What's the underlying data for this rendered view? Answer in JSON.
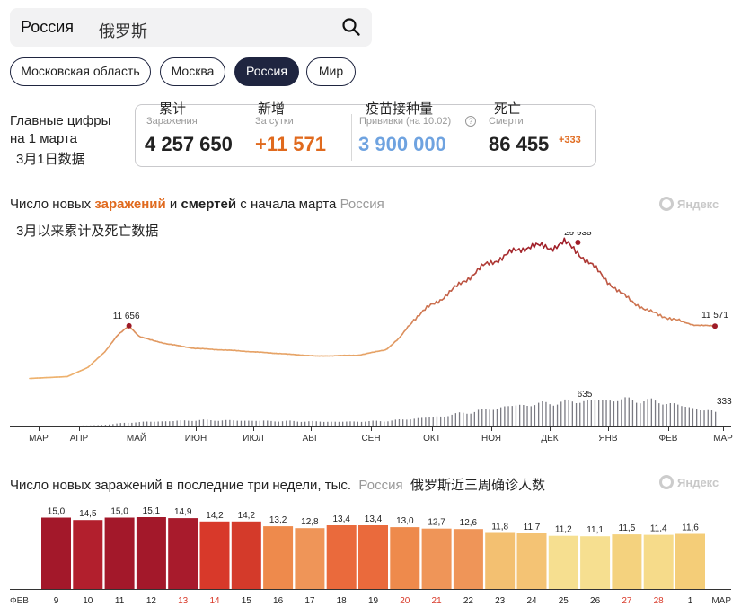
{
  "search": {
    "query": "Россия",
    "query_cn": "俄罗斯"
  },
  "regions": [
    "Московская область",
    "Москва",
    "Россия",
    "Мир"
  ],
  "regions_active": "Россия",
  "summary": {
    "title_line1": "Главные цифры",
    "title_line2": "на 1 марта",
    "subtitle_cn": "3月1日数据",
    "cases_cn": "累计",
    "cases_label": "Заражения",
    "cases_value": "4 257 650",
    "daily_cn": "新增",
    "daily_label": "За сутки",
    "daily_value": "+11 571",
    "vacc_cn": "疫苗接种量",
    "vacc_label": "Прививки (на 10.02)",
    "vacc_value": "3 900 000",
    "deaths_cn": "死亡",
    "deaths_label": "Смерти",
    "deaths_value": "86 455",
    "deaths_delta": "+333"
  },
  "colors": {
    "cases": "#e06a1e",
    "vaccine": "#6fa3e0",
    "deaths_delta": "#e06a1e",
    "active_chip": "#1f2540",
    "dark_red": "#9e1b27",
    "bars_grey": "#7a7a82"
  },
  "chart1": {
    "title_pre": "Число новых ",
    "title_cases": "заражений",
    "title_mid": " и ",
    "title_deaths": "смертей",
    "title_post": " с начала марта",
    "title_region": "Россия",
    "subtitle_cn": "3月以来累计及死亡数据",
    "watermark": "Яндекс"
  },
  "chart2": {
    "title": "Число новых заражений в последние три недели, тыс.",
    "title_region": "Россия",
    "title_cn": "俄罗斯近三周确诊人数",
    "watermark": "Яндекс"
  },
  "chart_data": [
    {
      "type": "line",
      "months": [
        "МАР",
        "АПР",
        "МАЙ",
        "ИЮН",
        "ИЮЛ",
        "АВГ",
        "СЕН",
        "ОКТ",
        "НОЯ",
        "ДЕК",
        "ЯНВ",
        "ФЕВ",
        "МАР"
      ],
      "cases_keypoints_x": [
        0,
        0.055,
        0.085,
        0.11,
        0.128,
        0.145,
        0.16,
        0.175,
        0.2,
        0.24,
        0.3,
        0.36,
        0.42,
        0.48,
        0.52,
        0.54,
        0.56,
        0.58,
        0.6,
        0.62,
        0.66,
        0.7,
        0.73,
        0.76,
        0.78,
        0.8,
        0.83,
        0.86,
        0.9,
        0.94,
        0.97,
        1.0
      ],
      "cases_keypoints": [
        100,
        500,
        2500,
        6000,
        9500,
        11656,
        9300,
        8600,
        7700,
        6700,
        6200,
        5600,
        5000,
        5200,
        6400,
        9000,
        13000,
        15500,
        17500,
        19800,
        24500,
        27500,
        29200,
        28800,
        29935,
        27800,
        23500,
        19000,
        15000,
        13000,
        11800,
        11571
      ],
      "deaths_keypoints_x": [
        0,
        0.1,
        0.15,
        0.25,
        0.35,
        0.45,
        0.52,
        0.6,
        0.7,
        0.8,
        0.87,
        0.92,
        1.0
      ],
      "deaths_keypoints": [
        0,
        30,
        100,
        150,
        130,
        110,
        130,
        240,
        480,
        600,
        635,
        580,
        333
      ],
      "labels": {
        "first_peak": "11 656",
        "max_cases": "29 935",
        "last_cases": "11 571",
        "max_deaths": "635",
        "last_deaths": "333"
      }
    },
    {
      "type": "bar",
      "categories": [
        "9",
        "10",
        "11",
        "12",
        "13",
        "14",
        "15",
        "16",
        "17",
        "18",
        "19",
        "20",
        "21",
        "22",
        "23",
        "24",
        "25",
        "26",
        "27",
        "28",
        "1"
      ],
      "weekend_flags": [
        false,
        false,
        false,
        false,
        true,
        true,
        false,
        false,
        false,
        false,
        false,
        true,
        true,
        false,
        false,
        false,
        false,
        false,
        true,
        true,
        false
      ],
      "values": [
        15.0,
        14.5,
        15.0,
        15.1,
        14.9,
        14.2,
        14.2,
        13.2,
        12.8,
        13.4,
        13.4,
        13.0,
        12.7,
        12.6,
        11.8,
        11.7,
        11.2,
        11.1,
        11.5,
        11.4,
        11.6
      ],
      "value_labels": [
        "15,0",
        "14,5",
        "15,0",
        "15,1",
        "14,9",
        "14,2",
        "14,2",
        "13,2",
        "12,8",
        "13,4",
        "13,4",
        "13,0",
        "12,7",
        "12,6",
        "11,8",
        "11,7",
        "11,2",
        "11,1",
        "11,5",
        "11,4",
        "11,6"
      ],
      "edge_labels": {
        "left": "ФЕВ",
        "right": "МАР"
      },
      "ylim": [
        0,
        15.1
      ]
    }
  ]
}
